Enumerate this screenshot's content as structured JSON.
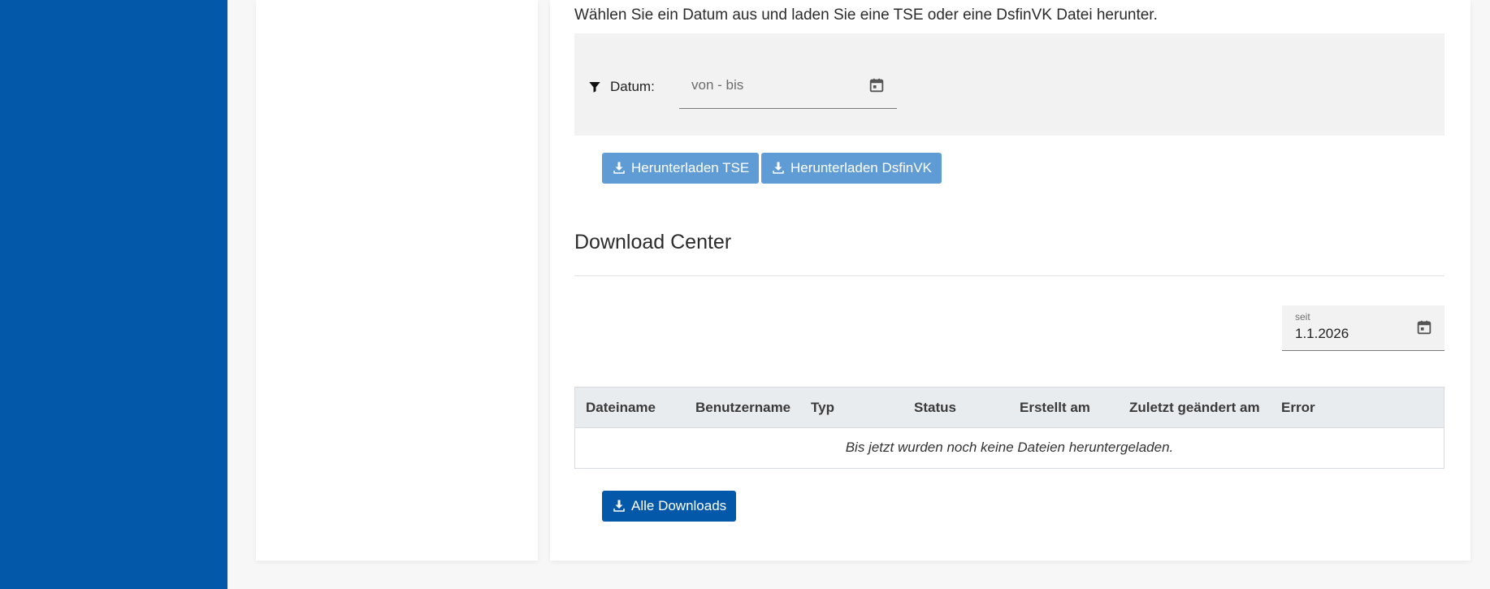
{
  "intro": {
    "text": "Wählen Sie ein Datum aus und laden Sie eine TSE oder eine DsfinVK Datei herunter."
  },
  "filter": {
    "label": "Datum:",
    "date_range_placeholder": "von - bis",
    "icon": "filter-icon"
  },
  "buttons": {
    "download_tse": "Herunterladen TSE",
    "download_dsfinvk": "Herunterladen DsfinVK",
    "all_downloads": "Alle Downloads"
  },
  "download_center": {
    "title": "Download Center",
    "since_field": {
      "label": "seit",
      "value": "1.1.2026"
    },
    "table": {
      "columns": [
        "Dateiname",
        "Benutzername",
        "Typ",
        "Status",
        "Erstellt am",
        "Zuletzt geändert am",
        "Error"
      ],
      "rows": [],
      "empty_message": "Bis jetzt wurden noch keine Dateien heruntergeladen."
    }
  },
  "colors": {
    "sidebar": "#0458a9",
    "primary_button": "#0458a9",
    "disabled_button": "#5f9bd4",
    "panel_background": "#f2f2f2",
    "table_header_background": "#e9ecef"
  }
}
